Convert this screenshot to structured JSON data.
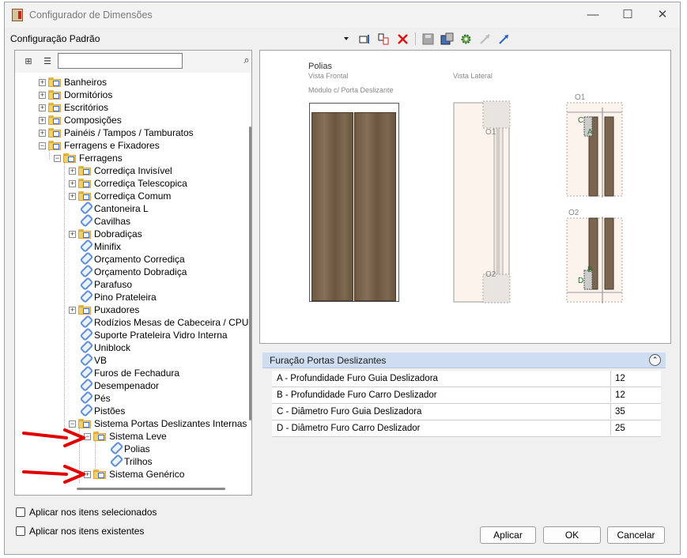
{
  "window": {
    "title": "Configurador de Dimensões",
    "minimize": "—",
    "maximize": "☐",
    "close": "✕"
  },
  "toolbar": {
    "config_label": "Configuração Padrão",
    "icons": [
      "dropdown-arrow-icon",
      "add-item-icon",
      "copy-item-icon",
      "delete-icon",
      "save-icon",
      "save-as-icon",
      "settings-icon",
      "expand-icon",
      "collapse-icon"
    ]
  },
  "left_panel": {
    "search_value": "",
    "tree": [
      {
        "label": "Banheiros",
        "type": "folder",
        "expander": "+"
      },
      {
        "label": "Dormitórios",
        "type": "folder",
        "expander": "+"
      },
      {
        "label": "Escritórios",
        "type": "folder",
        "expander": "+"
      },
      {
        "label": "Composições",
        "type": "folder",
        "expander": "+"
      },
      {
        "label": "Painéis / Tampos / Tamburatos",
        "type": "folder",
        "expander": "+"
      },
      {
        "label": "Ferragens e Fixadores",
        "type": "folder",
        "expander": "−"
      },
      {
        "label": "Ferragens",
        "type": "folder",
        "expander": "−"
      },
      {
        "label": "Corrediça Invisível",
        "type": "folder",
        "expander": "+"
      },
      {
        "label": "Corrediça Telescopica",
        "type": "folder",
        "expander": "+"
      },
      {
        "label": "Corrediça Comum",
        "type": "folder",
        "expander": "+"
      },
      {
        "label": "Cantoneira L",
        "type": "leaf",
        "expander": ""
      },
      {
        "label": "Cavilhas",
        "type": "leaf",
        "expander": ""
      },
      {
        "label": "Dobradiças",
        "type": "folder",
        "expander": "+"
      },
      {
        "label": "Minifix",
        "type": "leaf",
        "expander": ""
      },
      {
        "label": "Orçamento Corrediça",
        "type": "leaf",
        "expander": ""
      },
      {
        "label": "Orçamento Dobradiça",
        "type": "leaf",
        "expander": ""
      },
      {
        "label": "Parafuso",
        "type": "leaf",
        "expander": ""
      },
      {
        "label": "Pino Prateleira",
        "type": "leaf",
        "expander": ""
      },
      {
        "label": "Puxadores",
        "type": "folder",
        "expander": "+"
      },
      {
        "label": "Rodízios Mesas de Cabeceira / CPU",
        "type": "leaf",
        "expander": ""
      },
      {
        "label": "Suporte Prateleira Vidro Interna",
        "type": "leaf",
        "expander": ""
      },
      {
        "label": "Uniblock",
        "type": "leaf",
        "expander": ""
      },
      {
        "label": "VB",
        "type": "leaf",
        "expander": ""
      },
      {
        "label": "Furos de Fechadura",
        "type": "leaf",
        "expander": ""
      },
      {
        "label": "Desempenador",
        "type": "leaf",
        "expander": ""
      },
      {
        "label": "Pés",
        "type": "leaf",
        "expander": ""
      },
      {
        "label": "Pistões",
        "type": "leaf",
        "expander": ""
      },
      {
        "label": "Sistema Portas Deslizantes Internas",
        "type": "folder",
        "expander": "−"
      },
      {
        "label": "Sistema Leve",
        "type": "folder",
        "expander": "−"
      },
      {
        "label": "Polias",
        "type": "leaf",
        "expander": ""
      },
      {
        "label": "Trilhos",
        "type": "leaf",
        "expander": ""
      },
      {
        "label": "Sistema Genérico",
        "type": "folder",
        "expander": "+"
      }
    ]
  },
  "preview": {
    "title": "Polias",
    "front_view": "Vista Frontal",
    "side_view": "Vista Lateral",
    "module": "Módulo c/ Porta Deslizante",
    "markers": {
      "o1": "O1",
      "o2": "O2",
      "a": "A",
      "b": "B",
      "c": "C",
      "d": "D"
    }
  },
  "properties": {
    "group_title": "Furação Portas Deslizantes",
    "collapse_glyph": "⌃",
    "rows": [
      {
        "name": "A - Profundidade Furo Guia Deslizadora",
        "value": "12"
      },
      {
        "name": "B - Profundidade Furo Carro Deslizador",
        "value": "12"
      },
      {
        "name": "C - Diâmetro Furo Guia Deslizadora",
        "value": "35"
      },
      {
        "name": "D - Diâmetro Furo Carro Deslizador",
        "value": "25"
      }
    ]
  },
  "options": {
    "apply_selected": "Aplicar nos itens selecionados",
    "apply_existing": "Aplicar nos itens existentes"
  },
  "buttons": {
    "apply": "Aplicar",
    "ok": "OK",
    "cancel": "Cancelar"
  },
  "colors": {
    "group_header": "#cfddf0",
    "arrow": "#e00000",
    "wood": "#7a6550"
  }
}
